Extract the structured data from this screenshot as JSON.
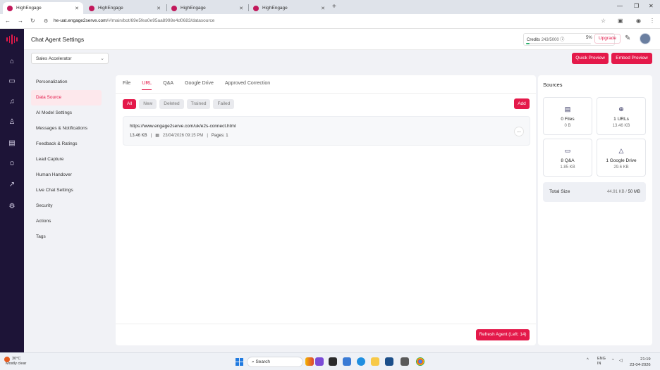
{
  "browser": {
    "tabs": [
      {
        "title": "HighEngage"
      },
      {
        "title": "HighEngage"
      },
      {
        "title": "HighEngage"
      },
      {
        "title": "HighEngage"
      }
    ],
    "url_host": "he-uat.engage2serve.com",
    "url_path": "/#/main/bot/69e5fea0e95aa8998e4d0683/datasource"
  },
  "header": {
    "title": "Chat Agent Settings",
    "credits_label": "Credits",
    "credits_value": "243/5000",
    "credits_percent": "5%",
    "credits_fraction": 0.05,
    "upgrade": "Upgrade"
  },
  "toolbar": {
    "agent": "Sales Accelerator",
    "quick_preview": "Quick Preview",
    "embed_preview": "Embed Preview"
  },
  "menu": [
    {
      "label": "Personalization"
    },
    {
      "label": "Data Source"
    },
    {
      "label": "AI Model Settings"
    },
    {
      "label": "Messages & Notifications"
    },
    {
      "label": "Feedback & Ratings"
    },
    {
      "label": "Lead Capture"
    },
    {
      "label": "Human Handover"
    },
    {
      "label": "Live Chat Settings"
    },
    {
      "label": "Security"
    },
    {
      "label": "Actions"
    },
    {
      "label": "Tags"
    }
  ],
  "main": {
    "tabs": [
      {
        "label": "File"
      },
      {
        "label": "URL"
      },
      {
        "label": "Q&A"
      },
      {
        "label": "Google Drive"
      },
      {
        "label": "Approved Correction"
      }
    ],
    "filters": [
      {
        "label": "All"
      },
      {
        "label": "New"
      },
      {
        "label": "Deleted"
      },
      {
        "label": "Trained"
      },
      {
        "label": "Failed"
      }
    ],
    "add": "Add",
    "items": [
      {
        "url": "https://www.engage2serve.com/uk/e2s-connect.html",
        "size": "13.46 KB",
        "date": "23/04/2026 09:15 PM",
        "pages": "Pages: 1",
        "more": "..."
      }
    ],
    "refresh": "Refresh Agent (Left: 14)"
  },
  "sources": {
    "title": "Sources",
    "cards": [
      {
        "name": "0 Files",
        "size": "0 B",
        "icon": "file-icon"
      },
      {
        "name": "1 URLs",
        "size": "13.46 KB",
        "icon": "globe-icon"
      },
      {
        "name": "8 Q&A",
        "size": "1.85 KB",
        "icon": "chat-icon"
      },
      {
        "name": "1 Google Drive",
        "size": "29.6 KB",
        "icon": "drive-icon"
      }
    ],
    "total_label": "Total Size",
    "total_used": "44.91 KB",
    "total_sep": " / ",
    "total_max": "50 MB"
  },
  "taskbar": {
    "temp": "30°C",
    "weather": "Mostly clear",
    "search": "Search",
    "lang": "ENG",
    "region": "IN",
    "time": "21:19",
    "date": "23-04-2026"
  },
  "colors": {
    "accent": "#e4194a",
    "nav_bg": "#1d1437",
    "progress": "#2fb36f"
  }
}
